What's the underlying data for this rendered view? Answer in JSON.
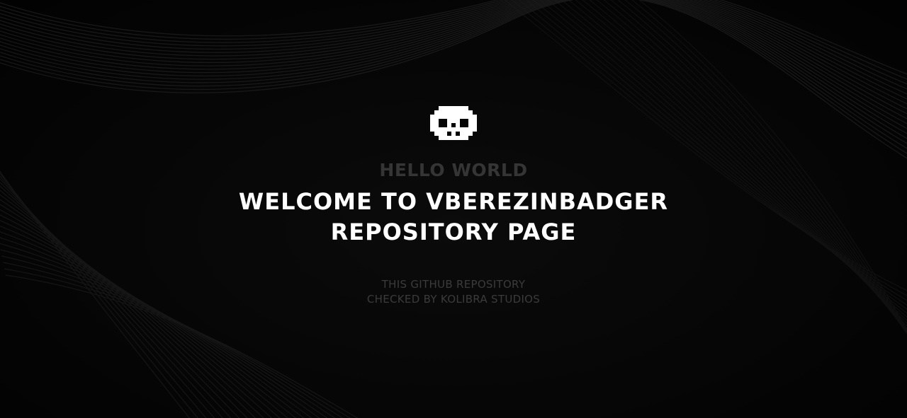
{
  "hero": {
    "logo_icon": "pixel-skull-icon",
    "eyebrow": "HELLO WORLD",
    "headline_line1": "WELCOME TO VBEREZINBADGER",
    "headline_line2": "REPOSITORY PAGE",
    "subtitle_line1": "THIS GITHUB REPOSITORY",
    "subtitle_line2": "CHECKED BY KOLIBRA STUDIOS"
  },
  "colors": {
    "background": "#050505",
    "headline": "#ffffff",
    "muted_text": "#353535",
    "wave_lines": "#2a2a2a"
  }
}
